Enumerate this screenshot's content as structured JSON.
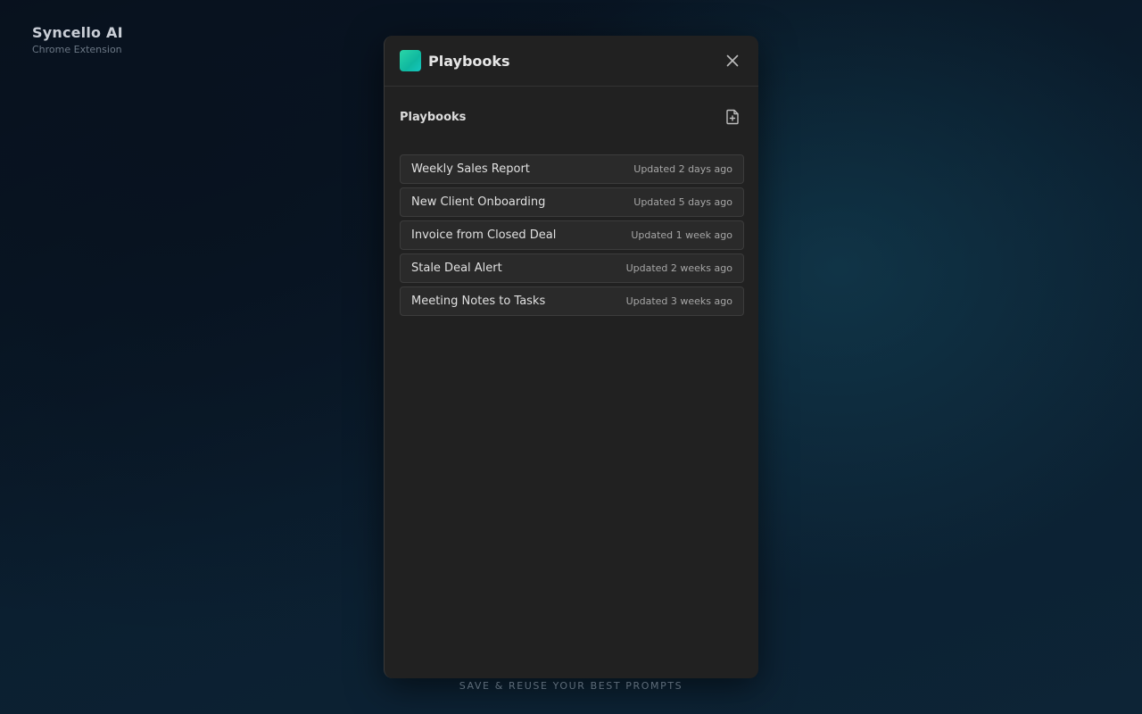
{
  "brand": {
    "title": "Syncello AI",
    "subtitle": "Chrome Extension"
  },
  "panel": {
    "title": "Playbooks",
    "logo_gradient": [
      "#2ad6a8",
      "#15c7c0"
    ],
    "close_icon": "close-icon"
  },
  "section": {
    "title": "Playbooks",
    "new_icon": "file-plus-icon"
  },
  "playbooks": [
    {
      "name": "Weekly Sales Report",
      "updated": "Updated 2 days ago"
    },
    {
      "name": "New Client Onboarding",
      "updated": "Updated 5 days ago"
    },
    {
      "name": "Invoice from Closed Deal",
      "updated": "Updated 1 week ago"
    },
    {
      "name": "Stale Deal Alert",
      "updated": "Updated 2 weeks ago"
    },
    {
      "name": "Meeting Notes to Tasks",
      "updated": "Updated 3 weeks ago"
    }
  ],
  "footer": {
    "tagline": "SAVE & REUSE YOUR BEST PROMPTS"
  }
}
